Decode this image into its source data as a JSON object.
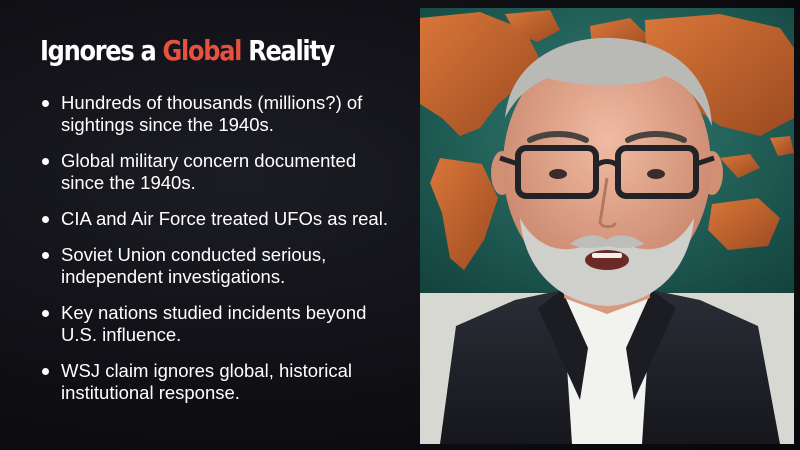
{
  "slide": {
    "title": {
      "before": "Ignores a ",
      "accent": "Global",
      "after": " Reality"
    },
    "bullets": [
      "Hundreds of thousands (millions?) of sightings since the 1940s.",
      "Global military concern documented since the 1940s.",
      "CIA and Air Force treated UFOs as real.",
      "Soviet Union conducted serious, independent investigations.",
      "Key nations studied incidents beyond U.S. influence.",
      "WSJ claim ignores global, historical institutional response."
    ]
  },
  "colors": {
    "background": "#0e0e13",
    "title_text": "#ffffff",
    "title_accent": "#e8503f",
    "bullet_text": "#ffffff",
    "map_ocean": "#1f5f58",
    "map_land": "#c9682e"
  },
  "video": {
    "background": "world-map-painting",
    "subject": "speaker-in-dark-suit"
  }
}
